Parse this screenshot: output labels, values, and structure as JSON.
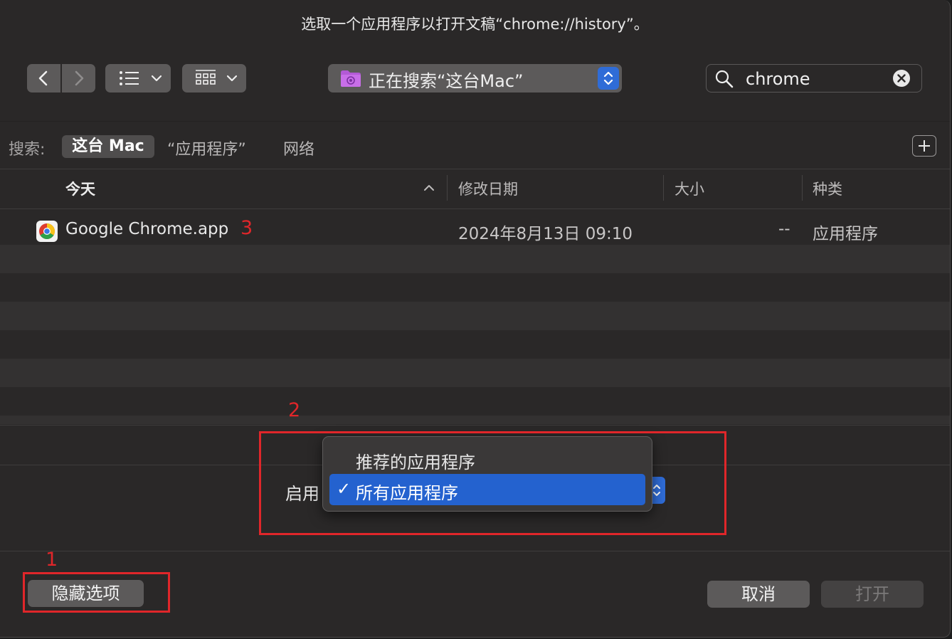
{
  "window": {
    "title": "选取一个应用程序以打开文稿“chrome://history”。"
  },
  "toolbar": {
    "location_label": "正在搜索“这台Mac”",
    "search_value": "chrome"
  },
  "scope": {
    "label": "搜索:",
    "items": [
      "这台 Mac",
      "“应用程序”",
      "网络"
    ]
  },
  "columns": [
    "今天",
    "修改日期",
    "大小",
    "种类"
  ],
  "rows": [
    {
      "name": "Google Chrome.app",
      "modified": "2024年8月13日 09:10",
      "size": "--",
      "kind": "应用程序"
    }
  ],
  "options": {
    "enable_label": "启用",
    "menu_items": [
      "推荐的应用程序",
      "所有应用程序"
    ],
    "selected_index": 1,
    "check_mark": "✓"
  },
  "buttons": {
    "hide_options": "隐藏选项",
    "cancel": "取消",
    "open": "打开"
  },
  "annotations": {
    "label_1": "1",
    "label_2": "2",
    "label_3": "3",
    "color": "#e0262a"
  },
  "colors": {
    "accent": "#2462cf",
    "background": "#2a2828"
  }
}
